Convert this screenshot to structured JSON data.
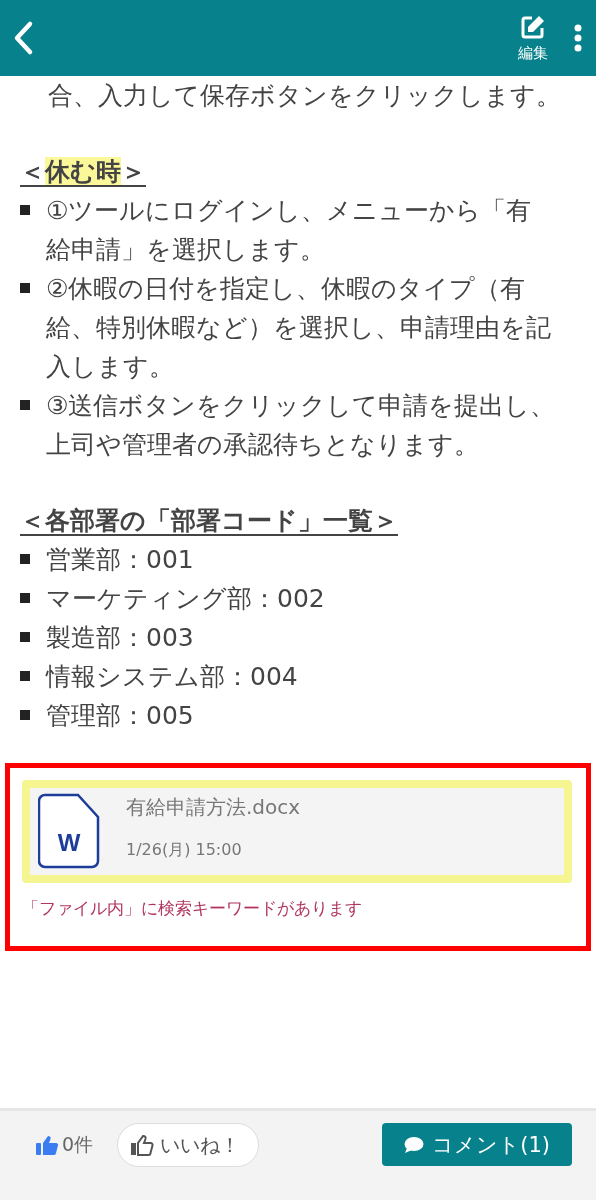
{
  "header": {
    "edit_label": "編集"
  },
  "content": [
    {
      "kind": "paragraph",
      "text": "合、入力して保存ボタンをクリックします。"
    },
    {
      "kind": "heading",
      "before": "＜",
      "highlighted": "休む時",
      "after": "＞"
    },
    {
      "kind": "list",
      "items": [
        "①ツールにログインし、メニューから「有給申請」を選択します。",
        "②休暇の日付を指定し、休暇のタイプ（有給、特別休暇など）を選択し、申請理由を記入します。",
        "③送信ボタンをクリックして申請を提出し、上司や管理者の承認待ちとなります。"
      ]
    },
    {
      "kind": "heading",
      "before": "＜各部署の「部署コード」一覧＞"
    },
    {
      "kind": "list",
      "items": [
        "営業部：001",
        "マーケティング部：002",
        "製造部：003",
        "情報システム部：004",
        "管理部：005"
      ]
    }
  ],
  "attachment": {
    "highlighted": true,
    "icon_letter": "W",
    "file_name": "有給申請方法.docx",
    "date": "1/26(月) 15:00",
    "note": "「ファイル内」に検索キーワードがあります"
  },
  "footer": {
    "like_count": "0件",
    "like_button": "いいね！",
    "comment_button": "コメント(1)"
  }
}
